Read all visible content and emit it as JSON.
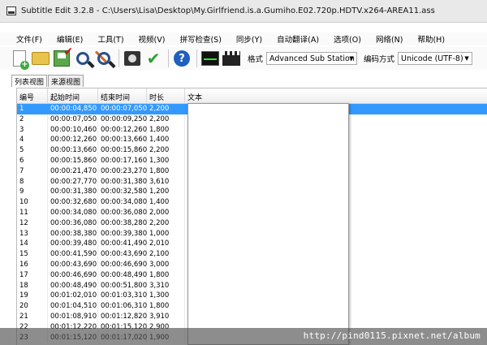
{
  "window": {
    "title": "Subtitle Edit 3.2.8 - C:\\Users\\Lisa\\Desktop\\My.Girlfriend.is.a.Gumiho.E02.720p.HDTV.x264-AREA11.ass"
  },
  "menu": [
    "文件(F)",
    "编辑(E)",
    "工具(T)",
    "视频(V)",
    "拼写检查(S)",
    "同步(Y)",
    "自动翻译(A)",
    "选项(O)",
    "网络(N)",
    "帮助(H)"
  ],
  "toolbar": {
    "format_label": "格式",
    "format_value": "Advanced Sub Station",
    "encoding_label": "编码方式",
    "encoding_value": "Unicode (UTF-8)"
  },
  "tabs": [
    "列表视图",
    "来源视图"
  ],
  "table": {
    "headers": [
      "编号",
      "起始时间",
      "结束时间",
      "时长",
      "文本"
    ],
    "rows": [
      [
        "1",
        "00:00:04,850",
        "00:00:07,050",
        "2,200"
      ],
      [
        "2",
        "00:00:07,050",
        "00:00:09,250",
        "2,200"
      ],
      [
        "3",
        "00:00:10,460",
        "00:00:12,260",
        "1,800"
      ],
      [
        "4",
        "00:00:12,260",
        "00:00:13,660",
        "1,400"
      ],
      [
        "5",
        "00:00:13,660",
        "00:00:15,860",
        "2,200"
      ],
      [
        "6",
        "00:00:15,860",
        "00:00:17,160",
        "1,300"
      ],
      [
        "7",
        "00:00:21,470",
        "00:00:23,270",
        "1,800"
      ],
      [
        "8",
        "00:00:27,770",
        "00:00:31,380",
        "3,610"
      ],
      [
        "9",
        "00:00:31,380",
        "00:00:32,580",
        "1,200"
      ],
      [
        "10",
        "00:00:32,680",
        "00:00:34,080",
        "1,400"
      ],
      [
        "11",
        "00:00:34,080",
        "00:00:36,080",
        "2,000"
      ],
      [
        "12",
        "00:00:36,080",
        "00:00:38,280",
        "2,200"
      ],
      [
        "13",
        "00:00:38,380",
        "00:00:39,380",
        "1,000"
      ],
      [
        "14",
        "00:00:39,480",
        "00:00:41,490",
        "2,010"
      ],
      [
        "15",
        "00:00:41,590",
        "00:00:43,690",
        "2,100"
      ],
      [
        "16",
        "00:00:43,690",
        "00:00:46,690",
        "3,000"
      ],
      [
        "17",
        "00:00:46,690",
        "00:00:48,490",
        "1,800"
      ],
      [
        "18",
        "00:00:48,490",
        "00:00:51,800",
        "3,310"
      ],
      [
        "19",
        "00:01:02,010",
        "00:01:03,310",
        "1,300"
      ],
      [
        "20",
        "00:01:04,510",
        "00:01:06,310",
        "1,800"
      ],
      [
        "21",
        "00:01:08,910",
        "00:01:12,820",
        "3,910"
      ],
      [
        "22",
        "00:01:12,220",
        "00:01:15,120",
        "2,900"
      ],
      [
        "23",
        "00:01:15,120",
        "00:01:17,020",
        "1,900"
      ]
    ]
  },
  "watermark": "http://pind0115.pixnet.net/album",
  "colors": {
    "selection": "#3399ff",
    "icon_green": "#2e9e2e",
    "icon_help": "#1f5fbf"
  },
  "icons": [
    "new-file-icon",
    "open-folder-icon",
    "save-icon",
    "find-icon",
    "replace-icon",
    "open-video-icon",
    "check-icon",
    "help-icon",
    "waveform-icon",
    "video-clapper-icon"
  ]
}
